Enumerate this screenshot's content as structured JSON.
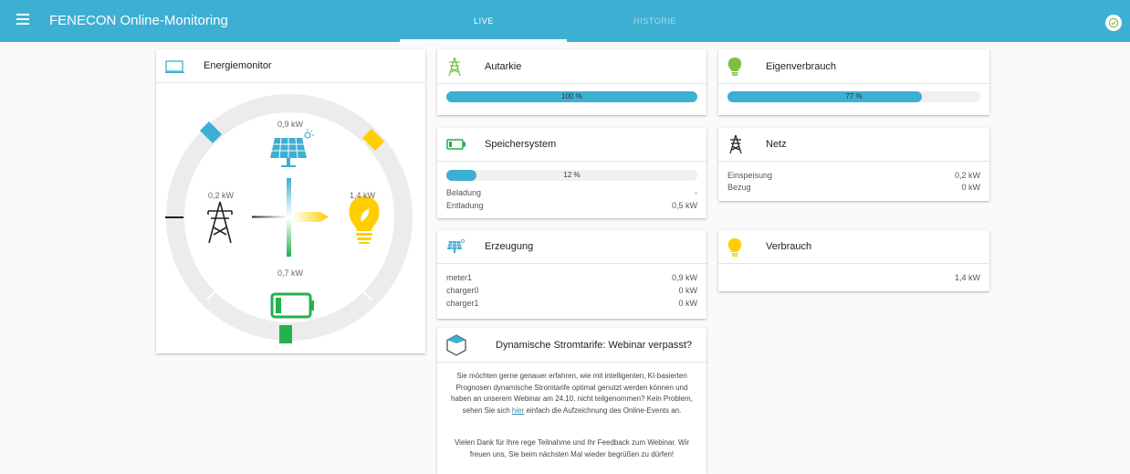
{
  "header": {
    "app_title": "FENECON Online-Monitoring",
    "tabs": [
      {
        "label": "LIVE",
        "active": true
      },
      {
        "label": "HISTORIE",
        "active": false
      }
    ],
    "status_icon": "check-circle-icon"
  },
  "energiemonitor": {
    "title": "Energiemonitor",
    "production_value": "0,9 kW",
    "grid_value": "0,2 kW",
    "consumption_value": "1,4 kW",
    "storage_value": "0,7 kW"
  },
  "autarkie": {
    "title": "Autarkie",
    "percent": 100,
    "bar_label": "100 %"
  },
  "eigenverbrauch": {
    "title": "Eigenverbrauch",
    "percent": 77,
    "bar_label": "77 %"
  },
  "speichersystem": {
    "title": "Speichersystem",
    "percent": 12,
    "bar_label": "12 %",
    "rows": [
      {
        "label": "Beladung",
        "value": "-"
      },
      {
        "label": "Entladung",
        "value": "0,5 kW"
      }
    ]
  },
  "netz": {
    "title": "Netz",
    "rows": [
      {
        "label": "Einspeisung",
        "value": "0,2 kW"
      },
      {
        "label": "Bezug",
        "value": "0 kW"
      }
    ]
  },
  "erzeugung": {
    "title": "Erzeugung",
    "rows": [
      {
        "label": "meter1",
        "value": "0,9 kW"
      },
      {
        "label": "charger0",
        "value": "0 kW"
      },
      {
        "label": "charger1",
        "value": "0 kW"
      }
    ]
  },
  "verbrauch": {
    "title": "Verbrauch",
    "value": "1,4 kW"
  },
  "webinar": {
    "title": "Dynamische Stromtarife: Webinar verpasst?",
    "para1_before": "Sie möchten gerne genauer erfahren, wie mit intelligenten, KI-basierten Prognosen dynamische Stromtarife optimal genutzt werden können und haben an unserem Webinar am 24.10. nicht teilgenommen? Kein Problem, sehen Sie sich ",
    "para1_link": "hier",
    "para1_after": " einfach die Aufzeichnung des Online-Events an.",
    "para2": "Vielen Dank für Ihre rege Teilnahme und Ihr Feedback zum Webinar. Wir freuen uns, Sie beim nächsten Mal wieder begrüßen zu dürfen!"
  },
  "colors": {
    "primary": "#3dafd3",
    "production": "#3dafd3",
    "consumption": "#ffce00",
    "storage": "#22b14c",
    "grid": "#222222",
    "bar_track": "#f0f0f0"
  }
}
